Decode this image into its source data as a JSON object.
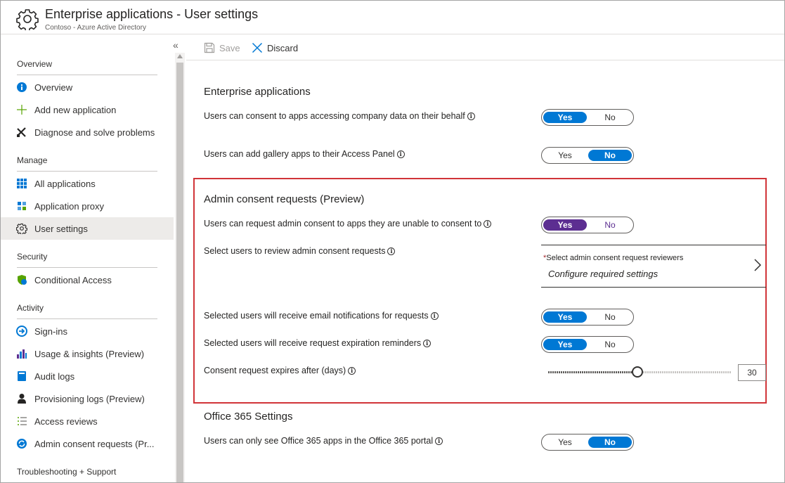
{
  "header": {
    "title": "Enterprise applications - User settings",
    "subtitle": "Contoso - Azure Active Directory"
  },
  "sidebar": {
    "collapse_glyph": "«",
    "sections": [
      {
        "title": "Overview",
        "items": [
          {
            "label": "Overview",
            "icon": "info-icon"
          },
          {
            "label": "Add new application",
            "icon": "plus-icon"
          },
          {
            "label": "Diagnose and solve problems",
            "icon": "tools-icon"
          }
        ]
      },
      {
        "title": "Manage",
        "items": [
          {
            "label": "All applications",
            "icon": "grid-icon"
          },
          {
            "label": "Application proxy",
            "icon": "proxy-icon"
          },
          {
            "label": "User settings",
            "icon": "gear-icon",
            "active": true
          }
        ]
      },
      {
        "title": "Security",
        "items": [
          {
            "label": "Conditional Access",
            "icon": "conditional-access-icon"
          }
        ]
      },
      {
        "title": "Activity",
        "items": [
          {
            "label": "Sign-ins",
            "icon": "sign-in-icon"
          },
          {
            "label": "Usage & insights (Preview)",
            "icon": "bar-chart-icon"
          },
          {
            "label": "Audit logs",
            "icon": "audit-log-icon"
          },
          {
            "label": "Provisioning logs (Preview)",
            "icon": "person-icon"
          },
          {
            "label": "Access reviews",
            "icon": "checklist-icon"
          },
          {
            "label": "Admin consent requests (Pr...",
            "icon": "consent-icon"
          }
        ]
      },
      {
        "title": "Troubleshooting + Support",
        "items": []
      }
    ]
  },
  "toolbar": {
    "save_label": "Save",
    "discard_label": "Discard"
  },
  "content": {
    "enterprise": {
      "heading": "Enterprise applications",
      "consent_label": "Users can consent to apps accessing company data on their behalf",
      "consent_value": "Yes",
      "gallery_label": "Users can add gallery apps to their Access Panel",
      "gallery_value": "No"
    },
    "admin_consent": {
      "heading": "Admin consent requests (Preview)",
      "request_label": "Users can request admin consent to apps they are unable to consent to",
      "request_value": "Yes",
      "reviewers_label": "Select users to review admin consent requests",
      "reviewers_required_star": "*",
      "reviewers_picker_title": "Select admin consent request reviewers",
      "reviewers_picker_value": "Configure required settings",
      "email_label": "Selected users will receive email notifications for requests",
      "email_value": "Yes",
      "reminder_label": "Selected users will receive request expiration reminders",
      "reminder_value": "Yes",
      "expires_label": "Consent request expires after (days)",
      "expires_days": "30",
      "slider_fraction": 0.49
    },
    "office365": {
      "heading": "Office 365 Settings",
      "only_see_label": "Users can only see Office 365 apps in the Office 365 portal",
      "only_see_value": "No"
    },
    "toggle_yes": "Yes",
    "toggle_no": "No",
    "info_glyph": "i"
  },
  "colors": {
    "accent": "#0078d4",
    "preview_accent": "#5c2e91",
    "highlight_border": "#d13438"
  }
}
